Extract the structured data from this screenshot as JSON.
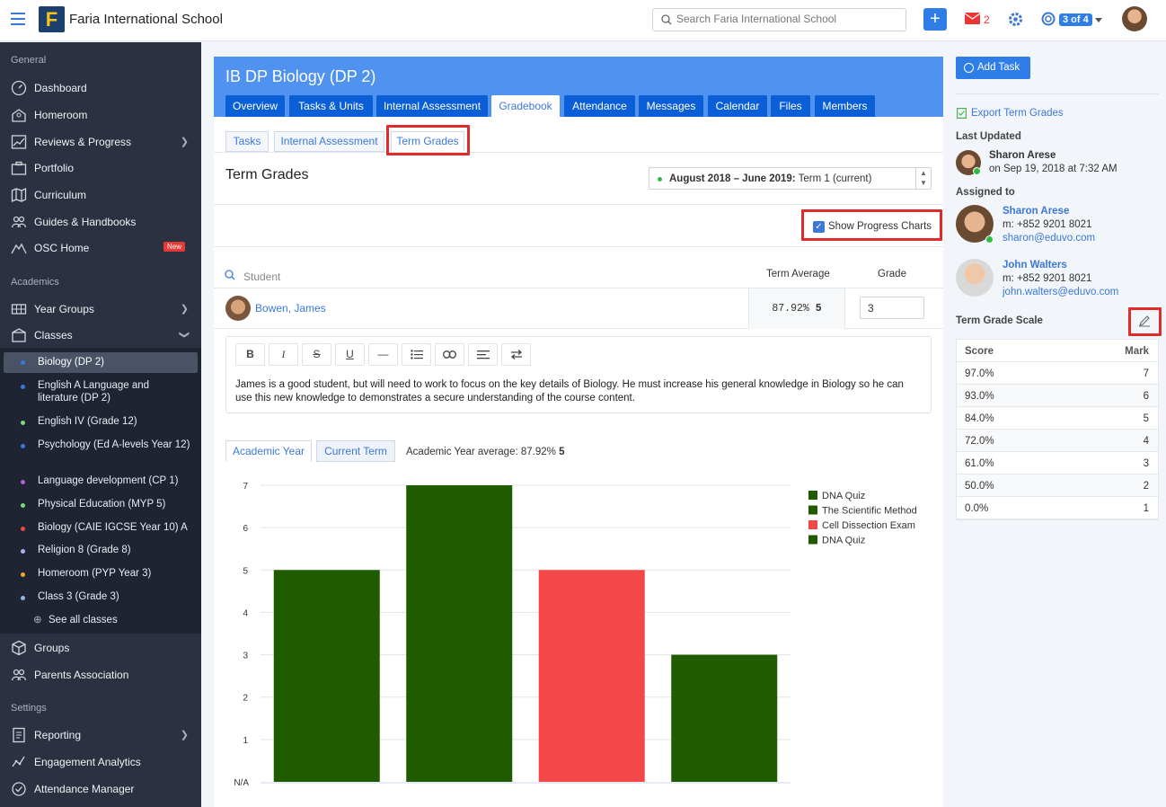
{
  "topbar": {
    "school_name": "Faria International School",
    "logo_letter": "F",
    "search_placeholder": "Search Faria International School",
    "add_label": "+",
    "mail_count": "2",
    "pager": "3 of 4"
  },
  "sidebar": {
    "sections": [
      "General",
      "Academics",
      "Settings"
    ],
    "general": [
      {
        "label": "Dashboard",
        "icon": "speedometer-icon"
      },
      {
        "label": "Homeroom",
        "icon": "school-icon"
      },
      {
        "label": "Reviews & Progress",
        "icon": "chart-line-icon"
      },
      {
        "label": "Portfolio",
        "icon": "briefcase-icon"
      },
      {
        "label": "Curriculum",
        "icon": "map-icon"
      },
      {
        "label": "Guides & Handbooks",
        "icon": "people-icon"
      },
      {
        "label": "OSC Home",
        "icon": "mountain-icon"
      }
    ],
    "new_badge": "New",
    "academics": [
      {
        "label": "Year Groups",
        "icon": "grid-icon"
      },
      {
        "label": "Classes",
        "icon": "building-icon"
      }
    ],
    "classes": [
      {
        "label": "Biology (DP 2)",
        "color": "#3b78d8"
      },
      {
        "label": "English A Language and literature (DP 2)",
        "color": "#3b78d8"
      },
      {
        "label": "English IV (Grade 12)",
        "color": "#7dd87d"
      },
      {
        "label": "Psychology (Ed A-levels Year 12)",
        "color": "#3b78d8"
      },
      {
        "label": "Language development (CP 1)",
        "color": "#b35fd6"
      },
      {
        "label": "Physical Education (MYP 5)",
        "color": "#7dd87d"
      },
      {
        "label": "Biology (CAIE IGCSE Year 10) A",
        "color": "#e84a4a"
      },
      {
        "label": "Religion 8 (Grade 8)",
        "color": "#b8a9e8"
      },
      {
        "label": "Homeroom (PYP Year 3)",
        "color": "#f5a623"
      },
      {
        "label": "Class 3 (Grade 3)",
        "color": "#8fb3e8"
      }
    ],
    "see_all": "See all classes",
    "more": [
      {
        "label": "Groups",
        "icon": "cube-icon"
      },
      {
        "label": "Parents Association",
        "icon": "people-icon"
      }
    ],
    "settings": [
      {
        "label": "Reporting",
        "icon": "report-icon"
      },
      {
        "label": "Engagement Analytics",
        "icon": "analytics-icon"
      },
      {
        "label": "Attendance Manager",
        "icon": "attendance-icon"
      }
    ]
  },
  "main": {
    "class_title": "IB DP Biology (DP 2)",
    "tabs": [
      "Overview",
      "Tasks & Units",
      "Internal Assessment",
      "Gradebook",
      "Attendance",
      "Messages",
      "Calendar",
      "Files",
      "Members"
    ],
    "active_tab": "Gradebook",
    "subtabs": [
      "Tasks",
      "Internal Assessment",
      "Term Grades"
    ],
    "section_title": "Term Grades",
    "term_bold": "August 2018 – June 2019:",
    "term_rest": " Term 1 (current)",
    "show_progress_label": "Show Progress Charts",
    "table": {
      "student_placeholder": "Student",
      "col_avg": "Term Average",
      "col_grade": "Grade",
      "student_name": "Bowen, James",
      "avg_value": "87.92%",
      "avg_grade": "5",
      "grade_input": "3"
    },
    "toolbar": [
      "B",
      "I",
      "S",
      "U",
      "—",
      "list",
      "link",
      "align",
      "swap"
    ],
    "comment": "James is a good student, but will need to work to focus on the key details of Biology. He must increase his general knowledge in Biology so he can use this new knowledge to demonstrates a secure understanding of the course content.",
    "chart_tabs": [
      "Academic Year",
      "Current Term"
    ],
    "ay_avg_label": "Academic Year average: 87.92%",
    "ay_avg_grade": "5"
  },
  "chart_data": {
    "type": "bar",
    "categories": [
      "DNA Quiz",
      "The Scientific Method",
      "Cell Dissection Exam",
      "DNA Quiz"
    ],
    "values": [
      5,
      7,
      5,
      3
    ],
    "colors": [
      "#1f5c00",
      "#1f5c00",
      "#f44747",
      "#1f5c00"
    ],
    "yticks": [
      "N/A",
      "1",
      "2",
      "3",
      "4",
      "5",
      "6",
      "7"
    ],
    "ylim": [
      0,
      7
    ],
    "legend": [
      {
        "name": "DNA Quiz",
        "color": "#1f5c00"
      },
      {
        "name": "The Scientific Method",
        "color": "#1f5c00"
      },
      {
        "name": "Cell Dissection Exam",
        "color": "#f44747"
      },
      {
        "name": "DNA Quiz",
        "color": "#1f5c00"
      }
    ],
    "legend_position": "top-right",
    "grid": true
  },
  "right": {
    "add_task": "Add Task",
    "export": "Export Term Grades",
    "last_updated_h": "Last Updated",
    "updater_name": "Sharon Arese",
    "updated_on": "on Sep 19, 2018 at 7:32 AM",
    "assigned_h": "Assigned to",
    "assignees": [
      {
        "name": "Sharon Arese",
        "phone": "m: +852 9201 8021",
        "email": "sharon@eduvo.com"
      },
      {
        "name": "John Walters",
        "phone": "m: +852 9201 8021",
        "email": "john.walters@eduvo.com"
      }
    ],
    "scale_h": "Term Grade Scale",
    "scale_cols": [
      "Score",
      "Mark"
    ],
    "scale": [
      [
        "97.0%",
        "7"
      ],
      [
        "93.0%",
        "6"
      ],
      [
        "84.0%",
        "5"
      ],
      [
        "72.0%",
        "4"
      ],
      [
        "61.0%",
        "3"
      ],
      [
        "50.0%",
        "2"
      ],
      [
        "0.0%",
        "1"
      ]
    ]
  }
}
